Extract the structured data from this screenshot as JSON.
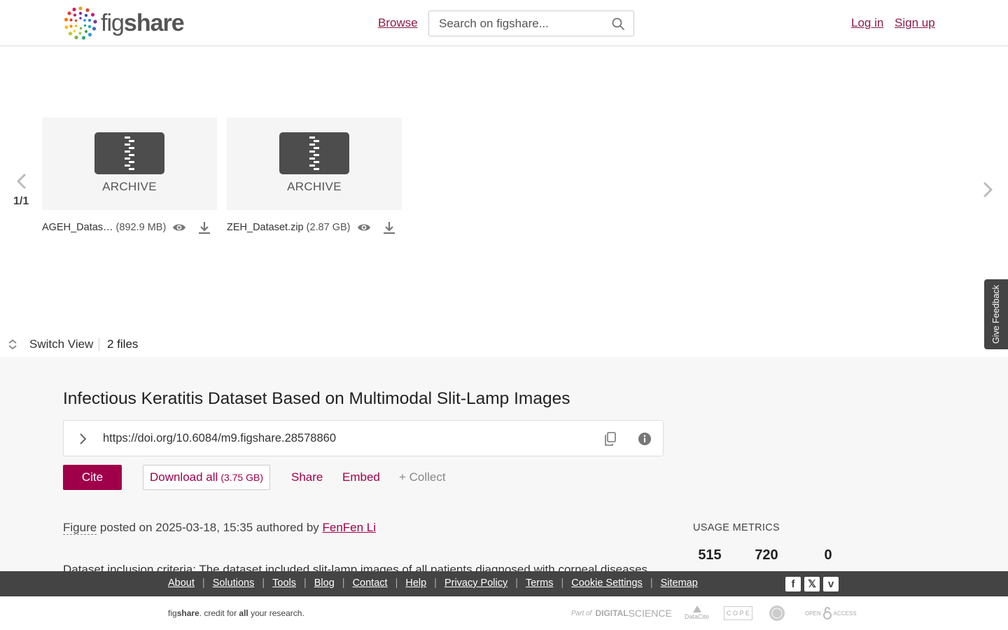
{
  "header": {
    "logo_fig": "fig",
    "logo_share": "share",
    "browse": "Browse",
    "search_placeholder": "Search on figshare...",
    "login": "Log in",
    "signup": "Sign up"
  },
  "carousel": {
    "page": "1/1",
    "files": [
      {
        "type": "ARCHIVE",
        "name": "AGEH_Datas…",
        "size": "(892.9 MB)"
      },
      {
        "type": "ARCHIVE",
        "name": "ZEH_Dataset.zip",
        "size": "(2.87 GB)"
      }
    ]
  },
  "feedback": "Give Feedback",
  "toolbar": {
    "switch_view": "Switch View",
    "file_count": "2 files"
  },
  "item": {
    "title": "Infectious Keratitis Dataset Based on Multimodal Slit-Lamp Images",
    "doi": "https://doi.org/10.6084/m9.figshare.28578860",
    "cite": "Cite",
    "download_all": "Download all",
    "download_size": "(3.75 GB)",
    "share": "Share",
    "embed": "Embed",
    "collect": "+ Collect",
    "type": "Figure",
    "posted_text": " posted on 2025-03-18, 15:35 authored by ",
    "author": "FenFen Li",
    "description": "Dataset inclusion criteria: The dataset included slit-lamp images of all patients diagnosed with corneal diseases at two"
  },
  "metrics": {
    "label": "USAGE METRICS",
    "values": [
      "515",
      "720",
      "0"
    ]
  },
  "footer": {
    "links": [
      "About",
      "Solutions",
      "Tools",
      "Blog",
      "Contact",
      "Help",
      "Privacy Policy",
      "Terms",
      "Cookie Settings",
      "Sitemap"
    ],
    "social": [
      "facebook-icon",
      "x-icon",
      "vimeo-icon"
    ],
    "tagline_fig": "fig",
    "tagline_share": "share",
    "tagline_mid": ". credit for ",
    "tagline_all": "all",
    "tagline_end": " your research.",
    "partners": [
      "Part of",
      "DIGITAL",
      "SCIENCE",
      "DataCite",
      "C O P E",
      "OPEN",
      "ACCESS"
    ]
  },
  "colors": {
    "accent": "#a0004a",
    "link": "#8b1a4a",
    "footer_bg": "#444444",
    "section_bg": "#f7f7f7"
  }
}
